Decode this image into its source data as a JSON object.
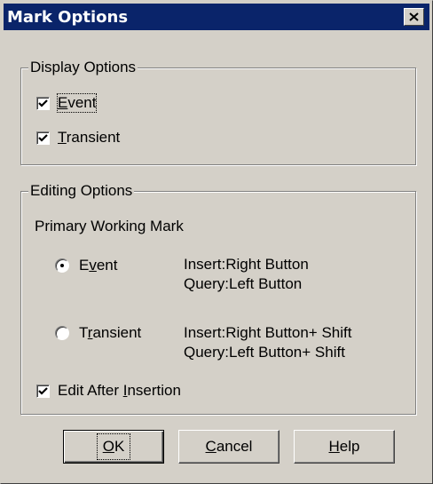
{
  "window": {
    "title": "Mark Options"
  },
  "display_options": {
    "legend": "Display Options",
    "event": {
      "prefix": "",
      "mnemonic": "E",
      "rest": "vent",
      "checked": true
    },
    "transient": {
      "prefix": "",
      "mnemonic": "T",
      "rest": "ransient",
      "checked": true
    }
  },
  "editing_options": {
    "legend": "Editing Options",
    "primary_label": "Primary Working Mark",
    "event": {
      "prefix": "E",
      "mnemonic": "v",
      "rest": "ent",
      "selected": true,
      "line1": "Insert:Right Button",
      "line2": "Query:Left Button"
    },
    "transient": {
      "prefix": "T",
      "mnemonic": "r",
      "rest": "ansient",
      "selected": false,
      "line1": "Insert:Right Button+ Shift",
      "line2": "Query:Left Button+ Shift"
    },
    "edit_after": {
      "prefix": "Edit After ",
      "mnemonic": "I",
      "rest": "nsertion",
      "checked": true
    }
  },
  "buttons": {
    "ok": {
      "prefix": "",
      "mnemonic": "O",
      "rest": "K"
    },
    "cancel": {
      "prefix": "",
      "mnemonic": "C",
      "rest": "ancel"
    },
    "help": {
      "prefix": "",
      "mnemonic": "H",
      "rest": "elp"
    }
  },
  "colors": {
    "titlebar": "#0a246a",
    "face": "#d4d0c8"
  }
}
